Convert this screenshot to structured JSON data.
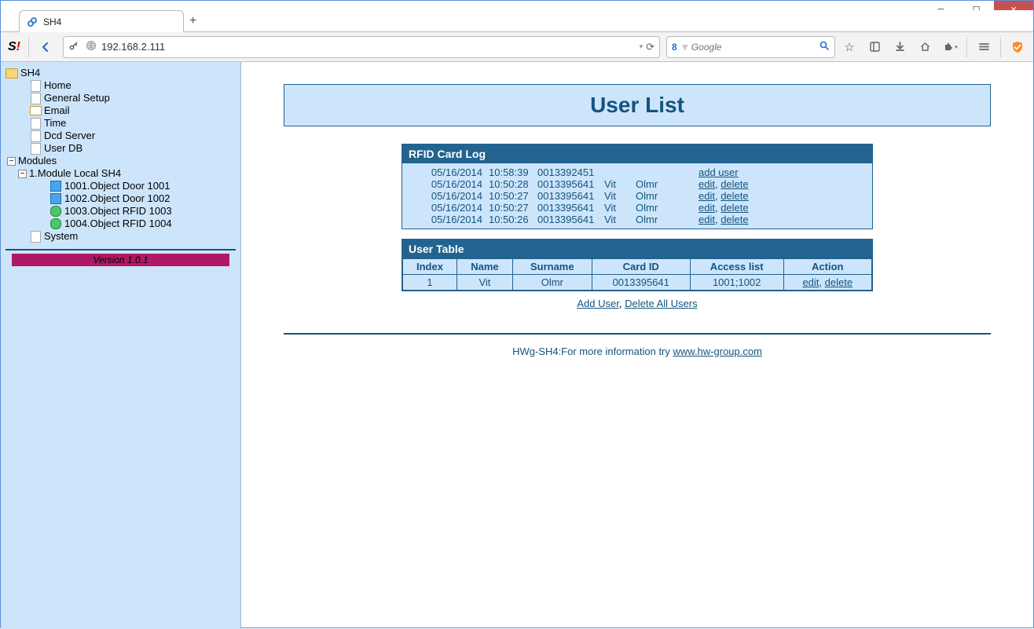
{
  "window": {
    "tab_title": "SH4",
    "newtab_glyph": "+"
  },
  "toolbar": {
    "url": "192.168.2.111",
    "search_placeholder": "Google",
    "search_engine_glyph": "8",
    "dropdown_glyph": "▾",
    "reload_glyph": "⟳"
  },
  "sidebar": {
    "root": "SH4",
    "home": "Home",
    "general_setup": "General Setup",
    "email": "Email",
    "time": "Time",
    "dcd_server": "Dcd Server",
    "user_db": "User DB",
    "modules": "Modules",
    "module1": "1.Module Local SH4",
    "obj1": "1001.Object Door 1001",
    "obj2": "1002.Object Door 1002",
    "obj3": "1003.Object RFID 1003",
    "obj4": "1004.Object RFID 1004",
    "system": "System",
    "version": "Version 1.0.1"
  },
  "page": {
    "title": "User List",
    "rfid_log_title": "RFID Card Log",
    "user_table_title": "User Table",
    "headers": {
      "index": "Index",
      "name": "Name",
      "surname": "Surname",
      "card_id": "Card ID",
      "access_list": "Access list",
      "action": "Action"
    },
    "rfid_log": [
      {
        "date": "05/16/2014",
        "time": "10:58:39",
        "card": "0013392451",
        "name": "",
        "surname": "",
        "action_a": "add user",
        "action_b": ""
      },
      {
        "date": "05/16/2014",
        "time": "10:50:28",
        "card": "0013395641",
        "name": "Vit",
        "surname": "Olmr",
        "action_a": "edit",
        "action_b": "delete"
      },
      {
        "date": "05/16/2014",
        "time": "10:50:27",
        "card": "0013395641",
        "name": "Vit",
        "surname": "Olmr",
        "action_a": "edit",
        "action_b": "delete"
      },
      {
        "date": "05/16/2014",
        "time": "10:50:27",
        "card": "0013395641",
        "name": "Vit",
        "surname": "Olmr",
        "action_a": "edit",
        "action_b": "delete"
      },
      {
        "date": "05/16/2014",
        "time": "10:50:26",
        "card": "0013395641",
        "name": "Vit",
        "surname": "Olmr",
        "action_a": "edit",
        "action_b": "delete"
      }
    ],
    "user_rows": [
      {
        "index": "1",
        "name": "Vit",
        "surname": "Olmr",
        "card_id": "0013395641",
        "access_list": "1001;1002",
        "action_a": "edit",
        "action_b": "delete"
      }
    ],
    "add_user": "Add User",
    "delete_all": "Delete All Users",
    "footer_prefix": "HWg-SH4:For more information try ",
    "footer_link": "www.hw-group.com",
    "edit": "edit",
    "delete": "delete",
    "comma": ", "
  }
}
